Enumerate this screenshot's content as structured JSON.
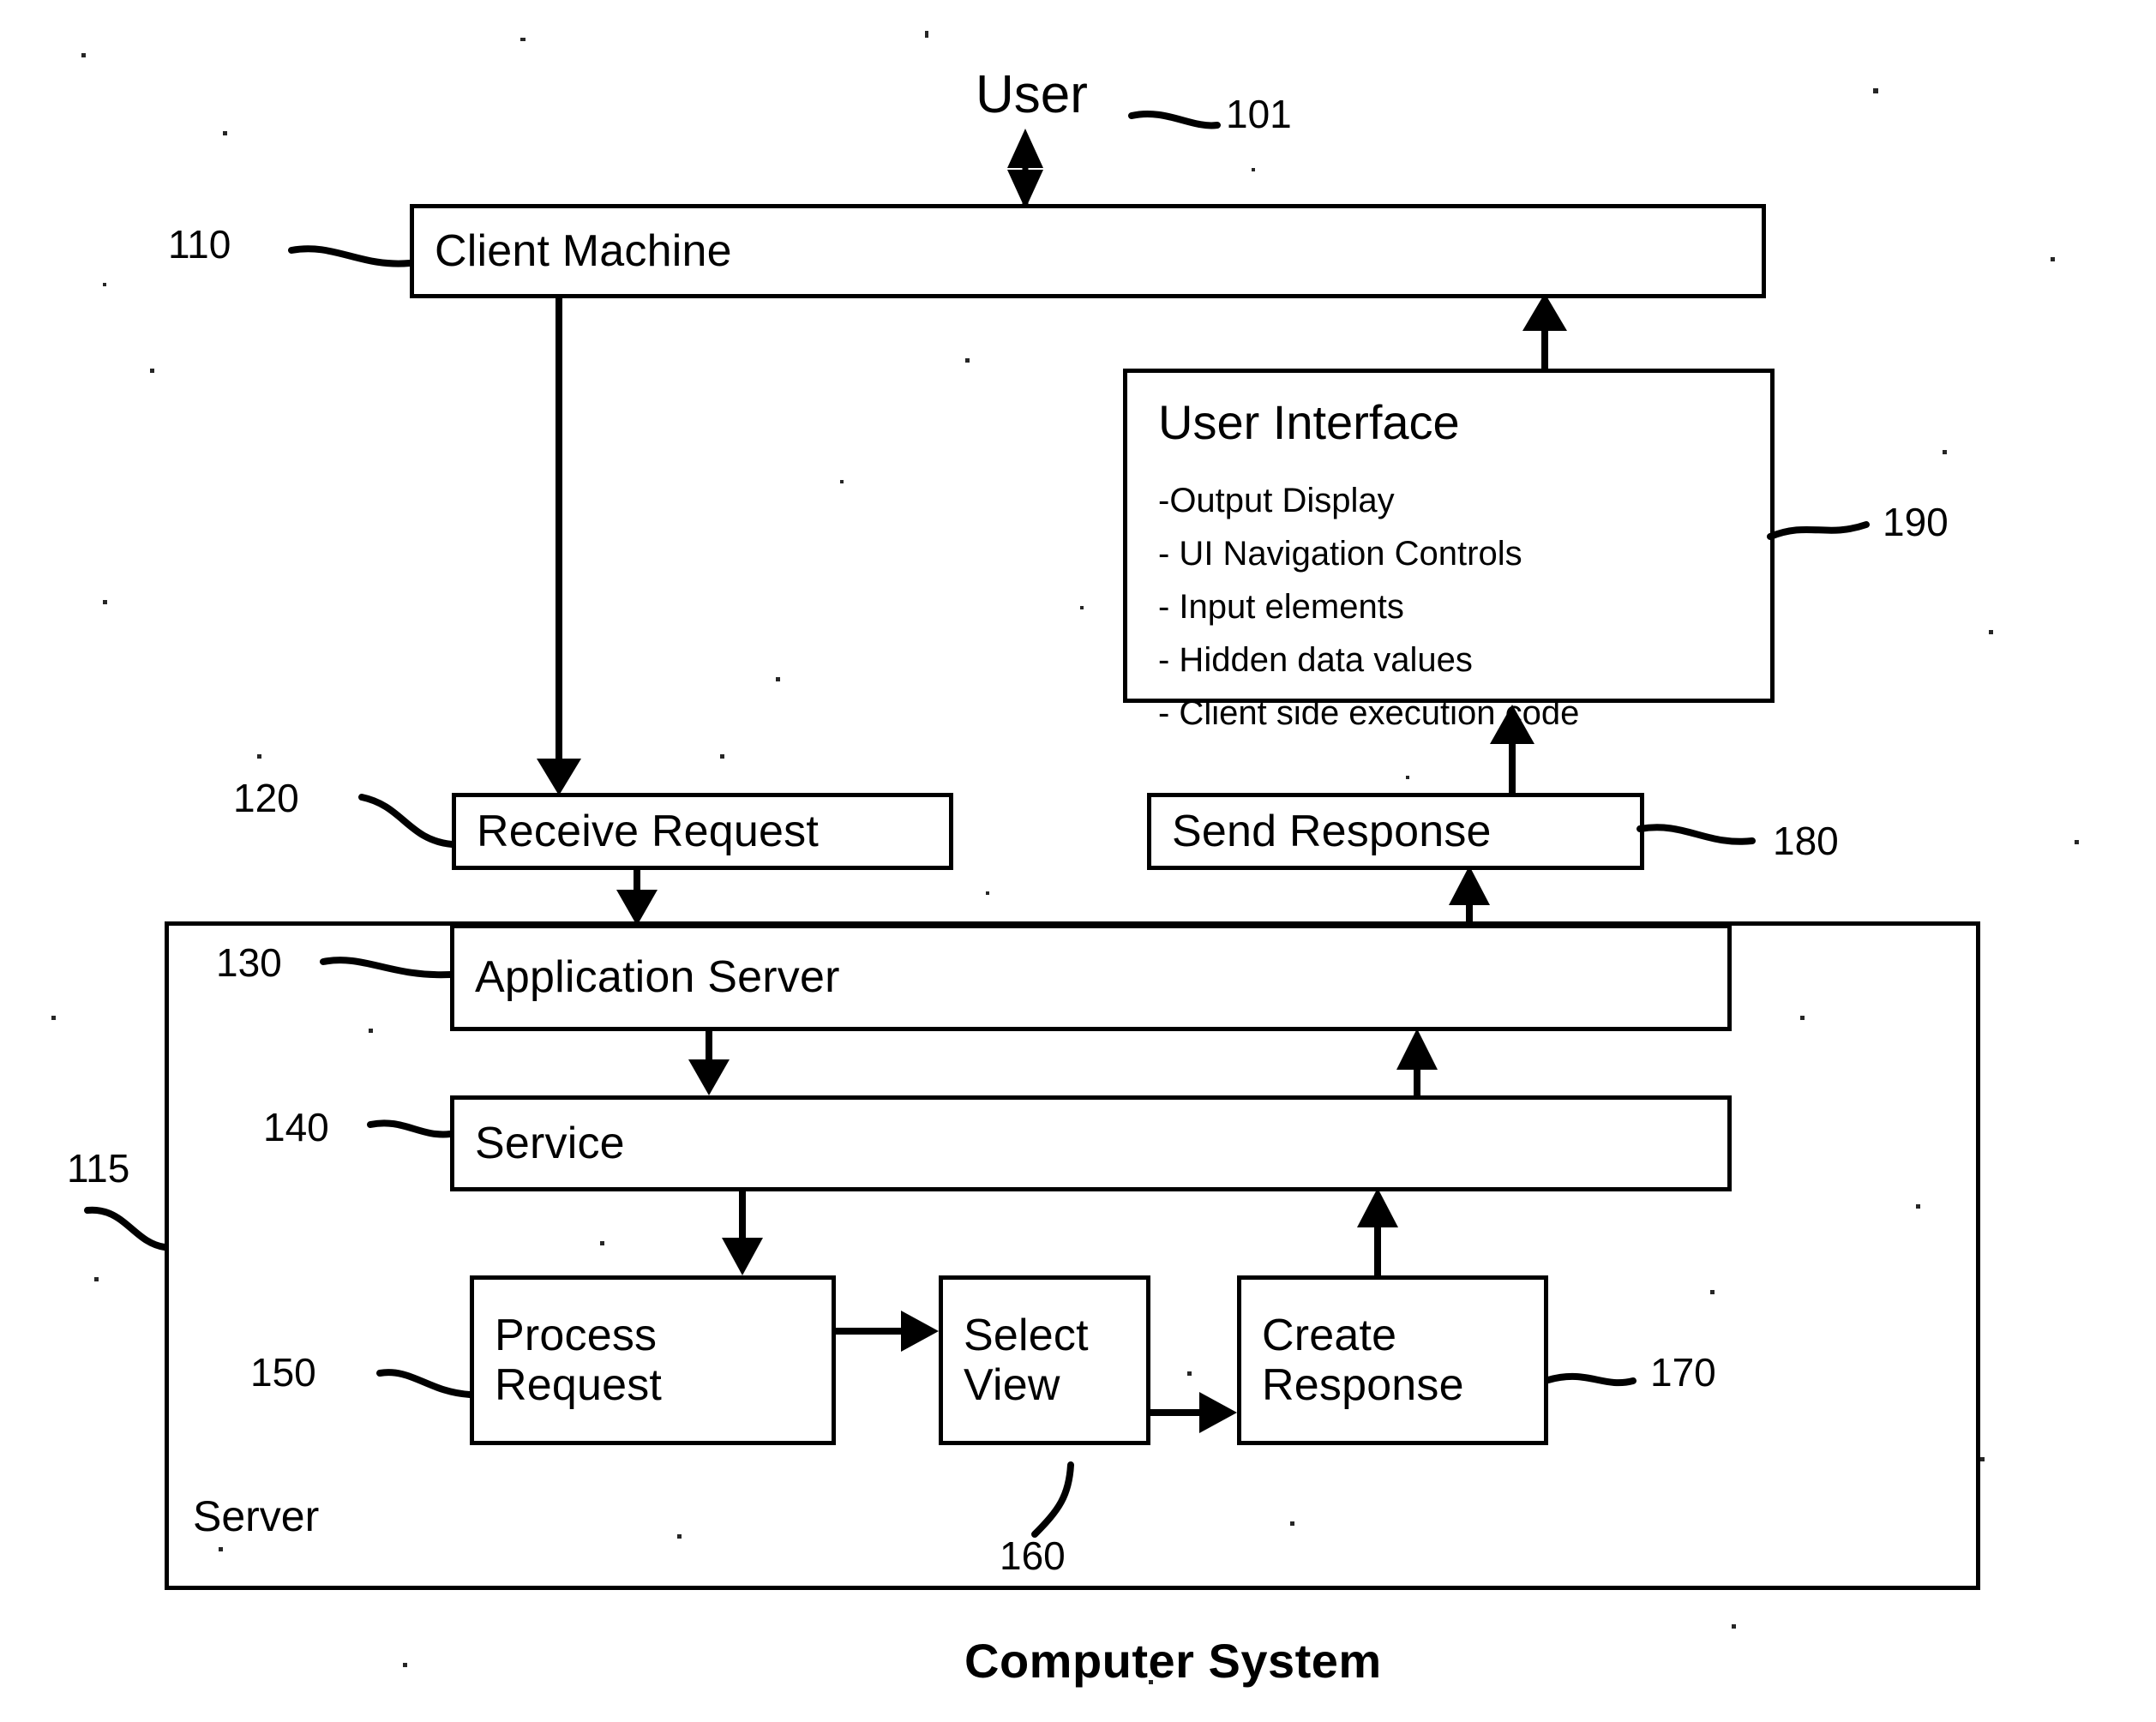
{
  "figure": {
    "caption": "Computer System",
    "actor": {
      "label": "User",
      "ref": "101"
    },
    "client": {
      "label": "Client Machine",
      "ref": "110"
    },
    "server_container": {
      "label": "Server",
      "ref": "115"
    },
    "user_interface": {
      "title": "User Interface",
      "ref": "190",
      "items": [
        "-Output Display",
        "- UI Navigation Controls",
        "- Input elements",
        "- Hidden data values",
        "- Client side execution code"
      ]
    },
    "nodes": [
      {
        "id": "receive-request",
        "label": "Receive Request",
        "ref": "120"
      },
      {
        "id": "send-response",
        "label": "Send Response",
        "ref": "180"
      },
      {
        "id": "application-server",
        "label": "Application Server",
        "ref": "130"
      },
      {
        "id": "service",
        "label": "Service",
        "ref": "140"
      },
      {
        "id": "process-request",
        "label": "Process\nRequest",
        "ref": "150"
      },
      {
        "id": "select-view",
        "label": "Select\nView",
        "ref": "160"
      },
      {
        "id": "create-response",
        "label": "Create\nResponse",
        "ref": "170"
      }
    ],
    "colors": {
      "ink": "#000000",
      "paper": "#ffffff"
    }
  }
}
